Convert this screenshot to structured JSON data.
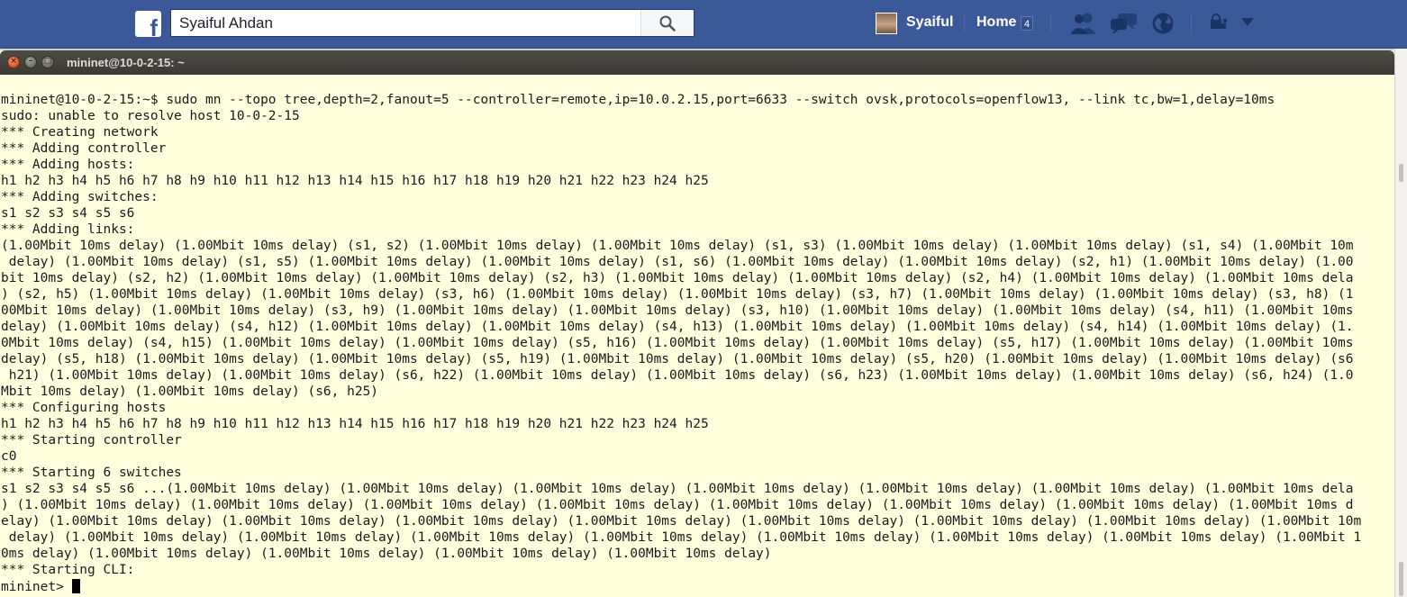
{
  "facebook": {
    "search_value": "Syaiful Ahdan",
    "user_name": "Syaiful",
    "home_label": "Home",
    "home_count": "4",
    "brand_color": "#3b5998",
    "logo_letter": "f",
    "icons": [
      "friend-requests-icon",
      "messages-icon",
      "notifications-globe-icon",
      "privacy-lock-icon",
      "account-menu-chevron-icon"
    ]
  },
  "terminal": {
    "title": "mininet@10-0-2-15: ~",
    "background": "#ffffdd",
    "buttons": [
      "close",
      "minimize",
      "maximize"
    ],
    "prompt": "mininet> ",
    "lines": [
      "mininet@10-0-2-15:~$ sudo mn --topo tree,depth=2,fanout=5 --controller=remote,ip=10.0.2.15,port=6633 --switch ovsk,protocols=openflow13, --link tc,bw=1,delay=10ms",
      "sudo: unable to resolve host 10-0-2-15",
      "*** Creating network",
      "*** Adding controller",
      "*** Adding hosts:",
      "h1 h2 h3 h4 h5 h6 h7 h8 h9 h10 h11 h12 h13 h14 h15 h16 h17 h18 h19 h20 h21 h22 h23 h24 h25",
      "*** Adding switches:",
      "s1 s2 s3 s4 s5 s6",
      "*** Adding links:",
      "(1.00Mbit 10ms delay) (1.00Mbit 10ms delay) (s1, s2) (1.00Mbit 10ms delay) (1.00Mbit 10ms delay) (s1, s3) (1.00Mbit 10ms delay) (1.00Mbit 10ms delay) (s1, s4) (1.00Mbit 10m",
      " delay) (1.00Mbit 10ms delay) (s1, s5) (1.00Mbit 10ms delay) (1.00Mbit 10ms delay) (s1, s6) (1.00Mbit 10ms delay) (1.00Mbit 10ms delay) (s2, h1) (1.00Mbit 10ms delay) (1.00",
      "bit 10ms delay) (s2, h2) (1.00Mbit 10ms delay) (1.00Mbit 10ms delay) (s2, h3) (1.00Mbit 10ms delay) (1.00Mbit 10ms delay) (s2, h4) (1.00Mbit 10ms delay) (1.00Mbit 10ms dela",
      ") (s2, h5) (1.00Mbit 10ms delay) (1.00Mbit 10ms delay) (s3, h6) (1.00Mbit 10ms delay) (1.00Mbit 10ms delay) (s3, h7) (1.00Mbit 10ms delay) (1.00Mbit 10ms delay) (s3, h8) (1",
      "00Mbit 10ms delay) (1.00Mbit 10ms delay) (s3, h9) (1.00Mbit 10ms delay) (1.00Mbit 10ms delay) (s3, h10) (1.00Mbit 10ms delay) (1.00Mbit 10ms delay) (s4, h11) (1.00Mbit 10ms",
      "delay) (1.00Mbit 10ms delay) (s4, h12) (1.00Mbit 10ms delay) (1.00Mbit 10ms delay) (s4, h13) (1.00Mbit 10ms delay) (1.00Mbit 10ms delay) (s4, h14) (1.00Mbit 10ms delay) (1.",
      "0Mbit 10ms delay) (s4, h15) (1.00Mbit 10ms delay) (1.00Mbit 10ms delay) (s5, h16) (1.00Mbit 10ms delay) (1.00Mbit 10ms delay) (s5, h17) (1.00Mbit 10ms delay) (1.00Mbit 10ms",
      "delay) (s5, h18) (1.00Mbit 10ms delay) (1.00Mbit 10ms delay) (s5, h19) (1.00Mbit 10ms delay) (1.00Mbit 10ms delay) (s5, h20) (1.00Mbit 10ms delay) (1.00Mbit 10ms delay) (s6",
      " h21) (1.00Mbit 10ms delay) (1.00Mbit 10ms delay) (s6, h22) (1.00Mbit 10ms delay) (1.00Mbit 10ms delay) (s6, h23) (1.00Mbit 10ms delay) (1.00Mbit 10ms delay) (s6, h24) (1.0",
      "Mbit 10ms delay) (1.00Mbit 10ms delay) (s6, h25)",
      "*** Configuring hosts",
      "h1 h2 h3 h4 h5 h6 h7 h8 h9 h10 h11 h12 h13 h14 h15 h16 h17 h18 h19 h20 h21 h22 h23 h24 h25",
      "*** Starting controller",
      "c0",
      "*** Starting 6 switches",
      "s1 s2 s3 s4 s5 s6 ...(1.00Mbit 10ms delay) (1.00Mbit 10ms delay) (1.00Mbit 10ms delay) (1.00Mbit 10ms delay) (1.00Mbit 10ms delay) (1.00Mbit 10ms delay) (1.00Mbit 10ms dela",
      ") (1.00Mbit 10ms delay) (1.00Mbit 10ms delay) (1.00Mbit 10ms delay) (1.00Mbit 10ms delay) (1.00Mbit 10ms delay) (1.00Mbit 10ms delay) (1.00Mbit 10ms delay) (1.00Mbit 10ms d",
      "elay) (1.00Mbit 10ms delay) (1.00Mbit 10ms delay) (1.00Mbit 10ms delay) (1.00Mbit 10ms delay) (1.00Mbit 10ms delay) (1.00Mbit 10ms delay) (1.00Mbit 10ms delay) (1.00Mbit 10m",
      " delay) (1.00Mbit 10ms delay) (1.00Mbit 10ms delay) (1.00Mbit 10ms delay) (1.00Mbit 10ms delay) (1.00Mbit 10ms delay) (1.00Mbit 10ms delay) (1.00Mbit 10ms delay) (1.00Mbit 1",
      "0ms delay) (1.00Mbit 10ms delay) (1.00Mbit 10ms delay) (1.00Mbit 10ms delay) (1.00Mbit 10ms delay)",
      "*** Starting CLI:"
    ]
  }
}
